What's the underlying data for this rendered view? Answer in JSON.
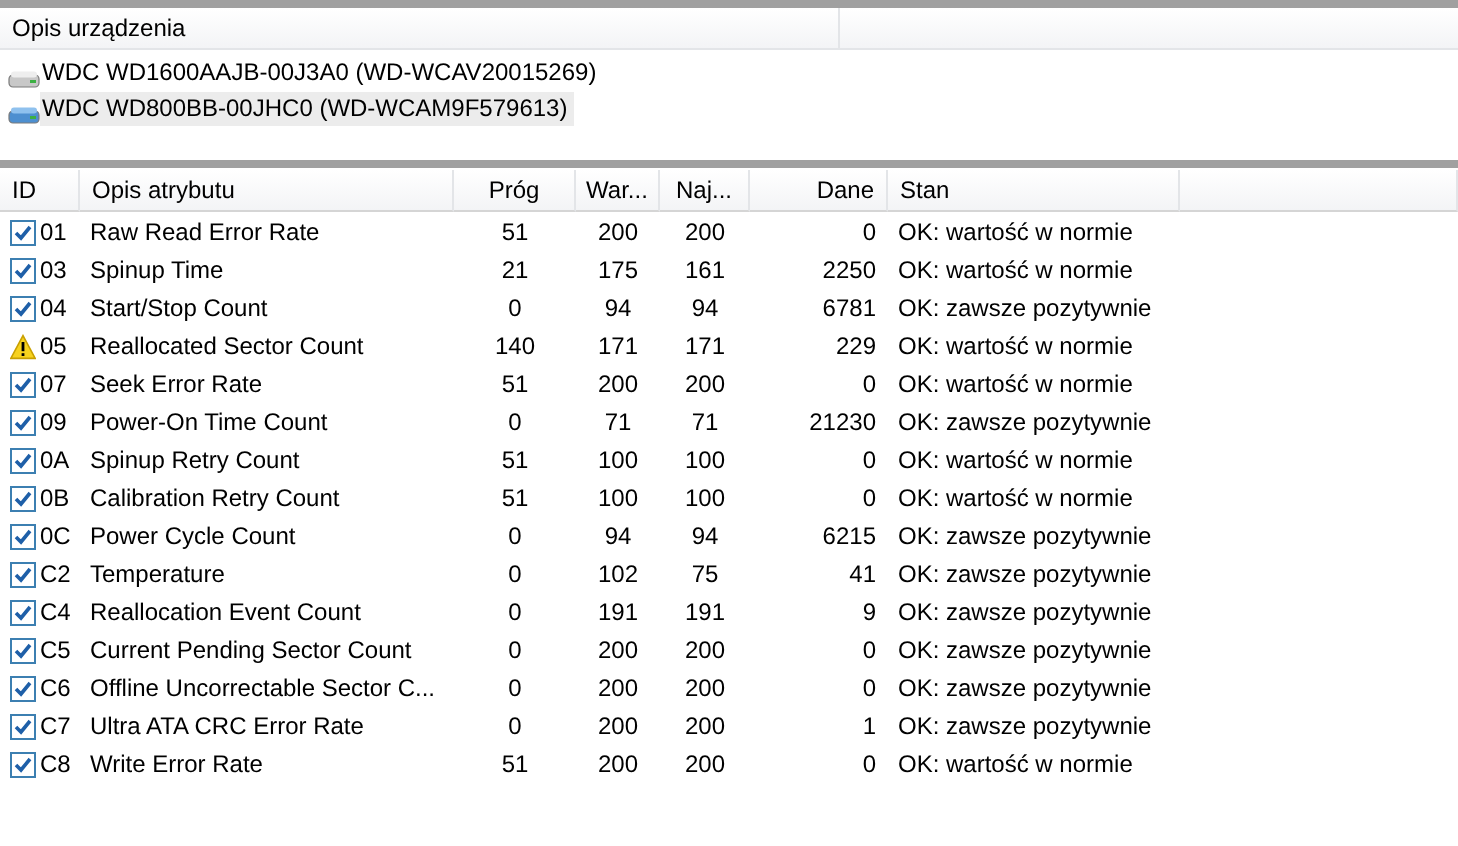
{
  "devices_panel": {
    "column": "Opis urządzenia",
    "devices": [
      {
        "label": "WDC WD1600AAJB-00J3A0 (WD-WCAV20015269)",
        "selected": false
      },
      {
        "label": "WDC WD800BB-00JHC0 (WD-WCAM9F579613)",
        "selected": true
      }
    ]
  },
  "table": {
    "columns": [
      "ID",
      "Opis atrybutu",
      "Próg",
      "War...",
      "Naj...",
      "Dane",
      "Stan"
    ],
    "rows": [
      {
        "kind": "check",
        "id": "01",
        "name": "Raw Read Error Rate",
        "threshold": "51",
        "value": "200",
        "worst": "200",
        "data": "0",
        "status": "OK: wartość w normie"
      },
      {
        "kind": "check",
        "id": "03",
        "name": "Spinup Time",
        "threshold": "21",
        "value": "175",
        "worst": "161",
        "data": "2250",
        "status": "OK: wartość w normie"
      },
      {
        "kind": "check",
        "id": "04",
        "name": "Start/Stop Count",
        "threshold": "0",
        "value": "94",
        "worst": "94",
        "data": "6781",
        "status": "OK: zawsze pozytywnie"
      },
      {
        "kind": "warning",
        "id": "05",
        "name": "Reallocated Sector Count",
        "threshold": "140",
        "value": "171",
        "worst": "171",
        "data": "229",
        "status": "OK: wartość w normie"
      },
      {
        "kind": "check",
        "id": "07",
        "name": "Seek Error Rate",
        "threshold": "51",
        "value": "200",
        "worst": "200",
        "data": "0",
        "status": "OK: wartość w normie"
      },
      {
        "kind": "check",
        "id": "09",
        "name": "Power-On Time Count",
        "threshold": "0",
        "value": "71",
        "worst": "71",
        "data": "21230",
        "status": "OK: zawsze pozytywnie"
      },
      {
        "kind": "check",
        "id": "0A",
        "name": "Spinup Retry Count",
        "threshold": "51",
        "value": "100",
        "worst": "100",
        "data": "0",
        "status": "OK: wartość w normie"
      },
      {
        "kind": "check",
        "id": "0B",
        "name": "Calibration Retry Count",
        "threshold": "51",
        "value": "100",
        "worst": "100",
        "data": "0",
        "status": "OK: wartość w normie"
      },
      {
        "kind": "check",
        "id": "0C",
        "name": "Power Cycle Count",
        "threshold": "0",
        "value": "94",
        "worst": "94",
        "data": "6215",
        "status": "OK: zawsze pozytywnie"
      },
      {
        "kind": "check",
        "id": "C2",
        "name": "Temperature",
        "threshold": "0",
        "value": "102",
        "worst": "75",
        "data": "41",
        "status": "OK: zawsze pozytywnie"
      },
      {
        "kind": "check",
        "id": "C4",
        "name": "Reallocation Event Count",
        "threshold": "0",
        "value": "191",
        "worst": "191",
        "data": "9",
        "status": "OK: zawsze pozytywnie"
      },
      {
        "kind": "check",
        "id": "C5",
        "name": "Current Pending Sector Count",
        "threshold": "0",
        "value": "200",
        "worst": "200",
        "data": "0",
        "status": "OK: zawsze pozytywnie"
      },
      {
        "kind": "check",
        "id": "C6",
        "name": "Offline Uncorrectable Sector C...",
        "threshold": "0",
        "value": "200",
        "worst": "200",
        "data": "0",
        "status": "OK: zawsze pozytywnie"
      },
      {
        "kind": "check",
        "id": "C7",
        "name": "Ultra ATA CRC Error Rate",
        "threshold": "0",
        "value": "200",
        "worst": "200",
        "data": "1",
        "status": "OK: zawsze pozytywnie"
      },
      {
        "kind": "check",
        "id": "C8",
        "name": "Write Error Rate",
        "threshold": "51",
        "value": "200",
        "worst": "200",
        "data": "0",
        "status": "OK: wartość w normie"
      }
    ]
  }
}
